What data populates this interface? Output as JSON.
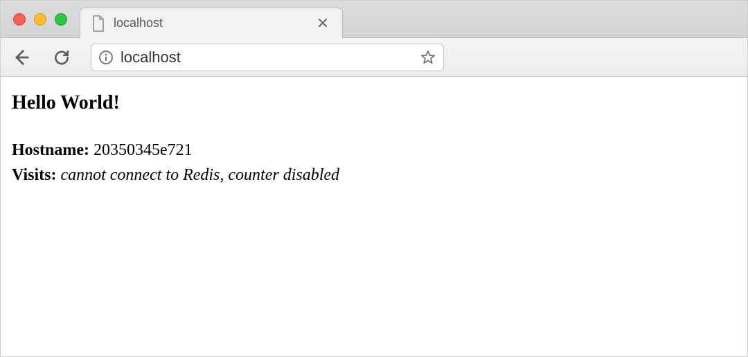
{
  "tab": {
    "title": "localhost"
  },
  "toolbar": {
    "url": "localhost"
  },
  "page": {
    "heading": "Hello World!",
    "hostname_label": "Hostname:",
    "hostname_value": "20350345e721",
    "visits_label": "Visits:",
    "visits_value": "cannot connect to Redis, counter disabled"
  },
  "colors": {
    "traffic_red": "#ff5f57",
    "traffic_yellow": "#ffbd2e",
    "traffic_green": "#28c940"
  }
}
